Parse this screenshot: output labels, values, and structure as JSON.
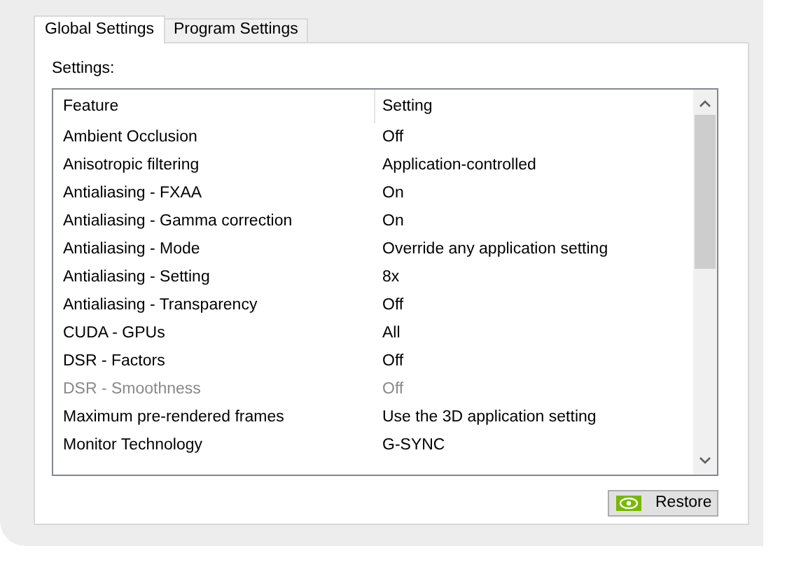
{
  "tabs": [
    {
      "label": "Global Settings",
      "selected": true
    },
    {
      "label": "Program Settings",
      "selected": false
    }
  ],
  "settings_label": "Settings:",
  "table": {
    "columns": [
      "Feature",
      "Setting"
    ],
    "rows": [
      {
        "feature": "Ambient Occlusion",
        "setting": "Off",
        "disabled": false
      },
      {
        "feature": "Anisotropic filtering",
        "setting": "Application-controlled",
        "disabled": false
      },
      {
        "feature": "Antialiasing - FXAA",
        "setting": "On",
        "disabled": false
      },
      {
        "feature": "Antialiasing - Gamma correction",
        "setting": "On",
        "disabled": false
      },
      {
        "feature": "Antialiasing - Mode",
        "setting": "Override any application setting",
        "disabled": false
      },
      {
        "feature": "Antialiasing - Setting",
        "setting": "8x",
        "disabled": false
      },
      {
        "feature": "Antialiasing - Transparency",
        "setting": "Off",
        "disabled": false
      },
      {
        "feature": "CUDA - GPUs",
        "setting": "All",
        "disabled": false
      },
      {
        "feature": "DSR - Factors",
        "setting": "Off",
        "disabled": false
      },
      {
        "feature": "DSR - Smoothness",
        "setting": "Off",
        "disabled": true
      },
      {
        "feature": "Maximum pre-rendered frames",
        "setting": "Use the 3D application setting",
        "disabled": false
      },
      {
        "feature": "Monitor Technology",
        "setting": "G-SYNC",
        "disabled": false
      }
    ]
  },
  "restore_button": "Restore"
}
